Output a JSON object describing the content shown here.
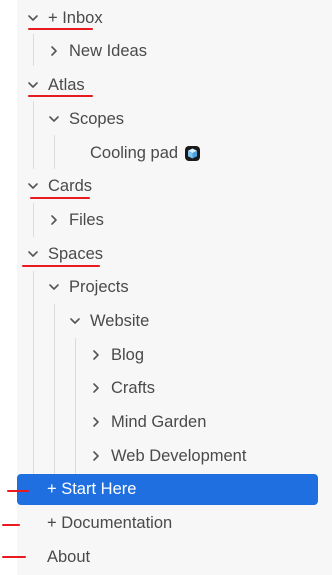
{
  "tree": {
    "items": [
      {
        "label": "+ Inbox",
        "state": "expanded"
      },
      {
        "label": "New Ideas",
        "state": "collapsed"
      },
      {
        "label": "Atlas",
        "state": "expanded"
      },
      {
        "label": "Scopes",
        "state": "expanded"
      },
      {
        "label": "Cooling pad",
        "state": "leaf",
        "icon": "cube-icon"
      },
      {
        "label": "Cards",
        "state": "expanded"
      },
      {
        "label": "Files",
        "state": "collapsed"
      },
      {
        "label": "Spaces",
        "state": "expanded"
      },
      {
        "label": "Projects",
        "state": "expanded"
      },
      {
        "label": "Website",
        "state": "expanded"
      },
      {
        "label": "Blog",
        "state": "collapsed"
      },
      {
        "label": "Crafts",
        "state": "collapsed"
      },
      {
        "label": "Mind Garden",
        "state": "collapsed"
      },
      {
        "label": "Web Development",
        "state": "collapsed"
      },
      {
        "label": "+ Start Here",
        "state": "leaf",
        "selected": true
      },
      {
        "label": "+ Documentation",
        "state": "leaf"
      },
      {
        "label": "About",
        "state": "leaf"
      }
    ]
  },
  "colors": {
    "accent": "#1f6fe0",
    "annotation": "#e8191f",
    "text": "#4a4a4a",
    "panel": "#f7f7f7"
  }
}
